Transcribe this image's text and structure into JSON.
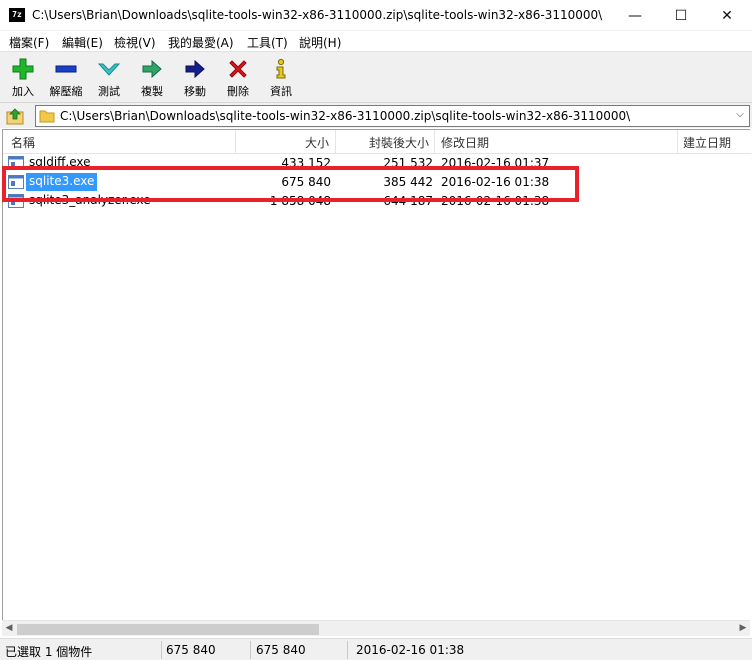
{
  "window": {
    "app_icon_text": "7z",
    "title": "C:\\Users\\Brian\\Downloads\\sqlite-tools-win32-x86-3110000.zip\\sqlite-tools-win32-x86-3110000\\",
    "controls": {
      "minimize": "—",
      "maximize": "☐",
      "close": "✕"
    }
  },
  "menu": [
    {
      "label": "檔案(F)"
    },
    {
      "label": "編輯(E)"
    },
    {
      "label": "檢視(V)"
    },
    {
      "label": "我的最愛(A)"
    },
    {
      "label": "工具(T)"
    },
    {
      "label": "說明(H)"
    }
  ],
  "toolbar": [
    {
      "label": "加入",
      "icon": "plus-icon"
    },
    {
      "label": "解壓縮",
      "icon": "minus-icon"
    },
    {
      "label": "測試",
      "icon": "check-icon"
    },
    {
      "label": "複製",
      "icon": "copy-arrow-icon"
    },
    {
      "label": "移動",
      "icon": "move-arrow-icon"
    },
    {
      "label": "刪除",
      "icon": "delete-x-icon"
    },
    {
      "label": "資訊",
      "icon": "info-icon"
    }
  ],
  "address": {
    "path": "C:\\Users\\Brian\\Downloads\\sqlite-tools-win32-x86-3110000.zip\\sqlite-tools-win32-x86-3110000\\",
    "dropdown_glyph": "⌵"
  },
  "columns": {
    "name": "名稱",
    "size": "大小",
    "packed": "封裝後大小",
    "modified": "修改日期",
    "created": "建立日期"
  },
  "files": [
    {
      "name": "sqldiff.exe",
      "size": "433 152",
      "packed": "251 532",
      "modified": "2016-02-16 01:37",
      "selected": false
    },
    {
      "name": "sqlite3.exe",
      "size": "675 840",
      "packed": "385 442",
      "modified": "2016-02-16 01:38",
      "selected": true
    },
    {
      "name": "sqlite3_analyzer.exe",
      "size": "1 858 048",
      "packed": "644 187",
      "modified": "2016-02-16 01:38",
      "selected": false
    }
  ],
  "status": {
    "selection": "已選取 1 個物件",
    "size": "675 840",
    "packed": "675 840",
    "modified": "2016-02-16 01:38"
  },
  "colors": {
    "highlight_border": "#e8212b",
    "selection_bg": "#3399ff"
  }
}
